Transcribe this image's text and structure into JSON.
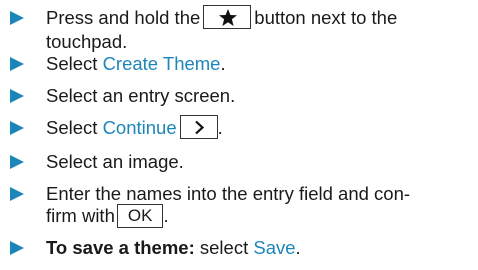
{
  "steps": [
    {
      "line1_before": "Press and hold the",
      "key_icon": "star-icon",
      "line1_after": "button next to the",
      "line2": "touchpad."
    },
    {
      "before": "Select ",
      "link": "Create Theme",
      "after": "."
    },
    {
      "text": "Select an entry screen."
    },
    {
      "before": "Select ",
      "link": "Continue",
      "key_icon": "chevron-right-icon",
      "after": "."
    },
    {
      "text": "Select an image."
    },
    {
      "line1": "Enter the names into the entry field and con-",
      "line2_before": "firm with",
      "key_label": "OK",
      "line2_after": "."
    },
    {
      "bold": "To save a theme:",
      "before": " select ",
      "link": "Save",
      "after": "."
    }
  ],
  "colors": {
    "accent": "#1d86b8",
    "text": "#1a1a1a"
  }
}
